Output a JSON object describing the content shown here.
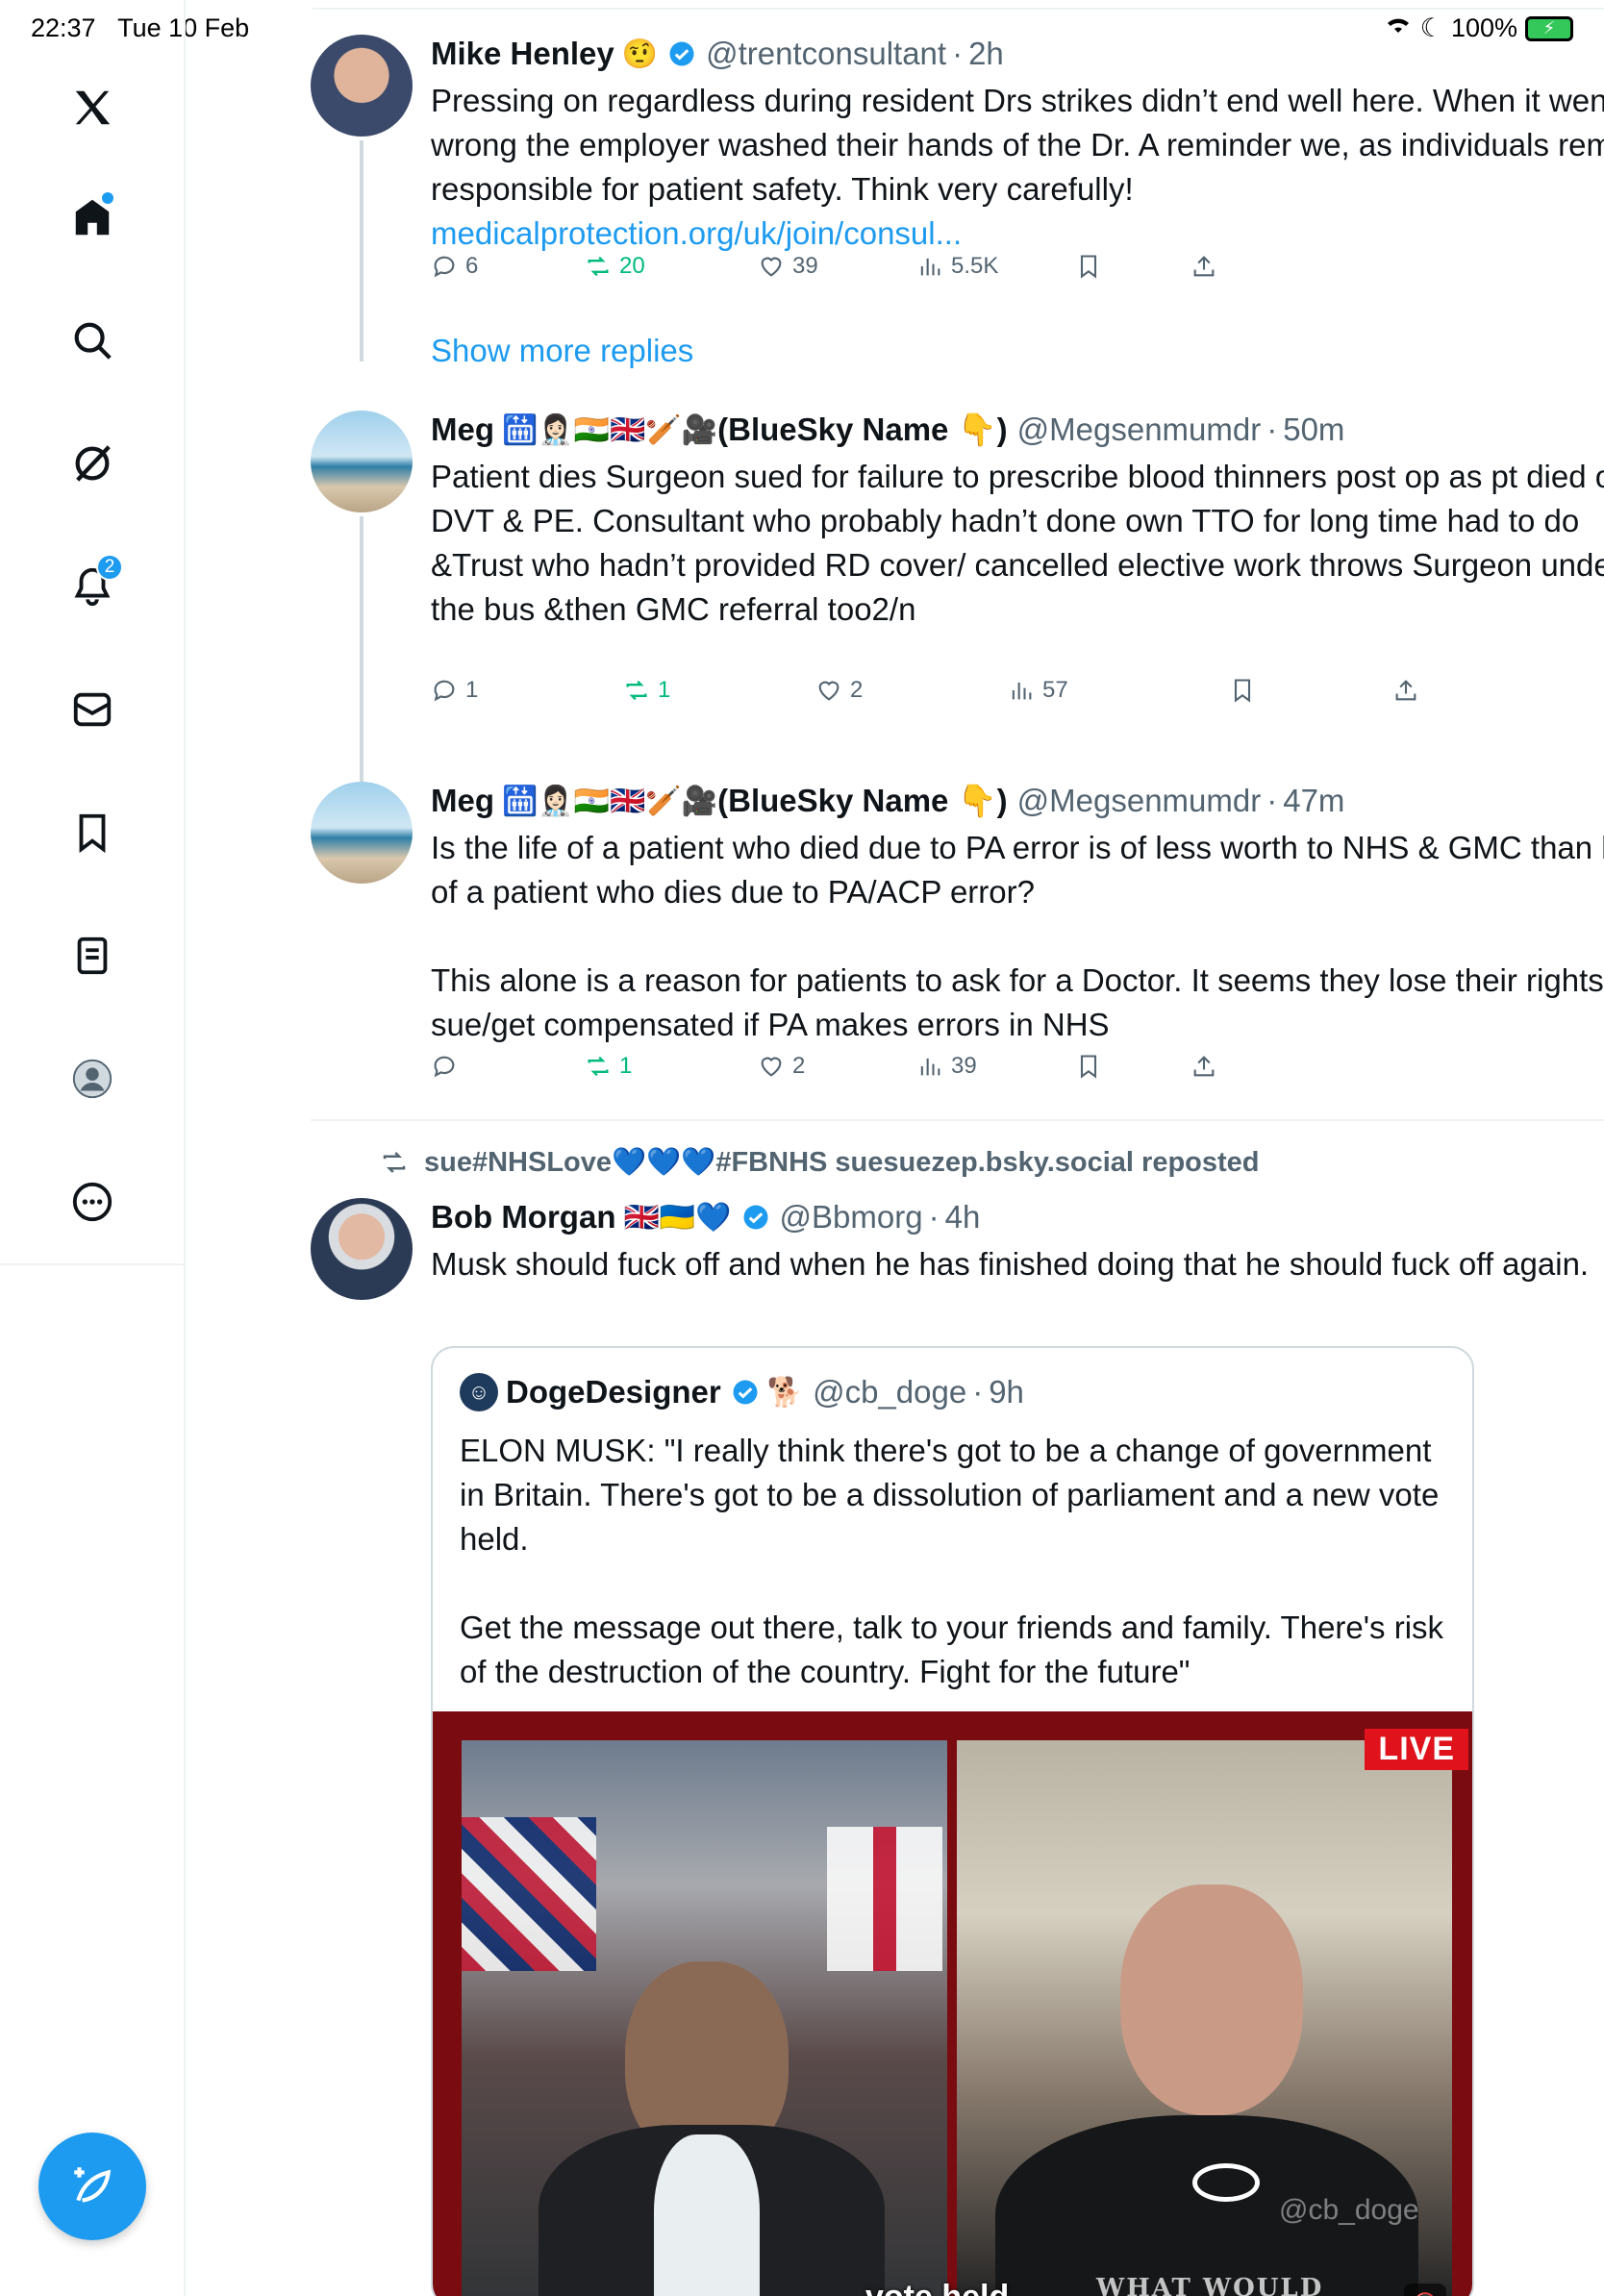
{
  "status": {
    "time": "22:37",
    "date": "Tue 10 Feb",
    "battery": "100%"
  },
  "sidebar": {
    "notifications_badge": "2"
  },
  "tweets": [
    {
      "name": "Mike Henley",
      "emoji": "🤨",
      "verified": true,
      "handle": "@trentconsultant",
      "time": "2h",
      "text": "Pressing on regardless during resident Drs strikes didn’t end well here. When it went wrong the employer washed their hands of the Dr. A reminder we, as individuals remain responsible for patient safety. Think very carefully! ",
      "link": "medicalprotection.org/uk/join/consul...",
      "replies": "6",
      "reposts": "20",
      "likes": "39",
      "views": "5.5K"
    },
    {
      "name": "Meg",
      "emoji": "🛗👩🏻‍⚕️🇮🇳🇬🇧🏏🎥",
      "name_suffix": "(BlueSky Name 👇)",
      "handle": "@Megsenmumdr",
      "time": "50m",
      "text": "Patient dies Surgeon sued for failure to prescribe blood thinners post op as pt died of DVT & PE. Consultant who probably hadn’t done own TTO for long time had to do &Trust who hadn’t provided RD cover/ cancelled elective work throws Surgeon under the bus &then GMC referral too2/n",
      "replies": "1",
      "reposts": "1",
      "likes": "2",
      "views": "57"
    },
    {
      "name": "Meg",
      "emoji": "🛗👩🏻‍⚕️🇮🇳🇬🇧🏏🎥",
      "name_suffix": "(BlueSky Name 👇)",
      "handle": "@Megsenmumdr",
      "time": "47m",
      "text": "Is the life of a patient who died due to PA error is of less worth to NHS & GMC than life of a patient who dies due to PA/ACP error?\n\nThis alone is a reason for patients to ask for a Doctor. It seems they lose their rights to sue/get compensated if PA makes errors in NHS",
      "replies": "",
      "reposts": "1",
      "likes": "2",
      "views": "39"
    },
    {
      "repost_by": "sue#NHSLove💙💙💙#FBNHS suesuezep.bsky.social reposted",
      "name": "Bob Morgan",
      "emoji": "🇬🇧🇺🇦💙",
      "verified": true,
      "handle": "@Bbmorg",
      "time": "4h",
      "text": "Musk should fuck off and when he has finished doing that he should fuck off again."
    }
  ],
  "show_more_replies": "Show more replies",
  "quote": {
    "name": "DogeDesigner",
    "emoji": "🐕",
    "handle": "@cb_doge",
    "time": "9h",
    "text": "ELON MUSK: \"I really think there's got to be a change of government in Britain. There's got to be a dissolution of parliament and a new vote held.\n\nGet the message out there, talk to your friends and family. There's risk of the destruction of the country. Fight for the future\"",
    "video_live": "LIVE",
    "video_caption": "vote held.",
    "video_watermark": "@cb_doge",
    "video_logo_text": "WHAT WOULD"
  },
  "colors": {
    "accent": "#1d9bf0",
    "repost_green": "#00ba7c",
    "secondary_text": "#536471"
  }
}
